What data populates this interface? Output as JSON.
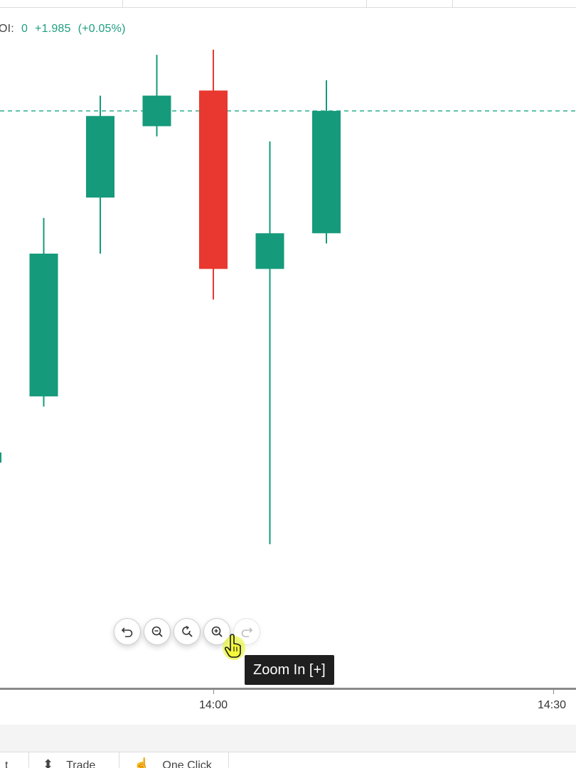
{
  "readout": {
    "label": "OI:",
    "oi_value": "0",
    "change": "+1.985",
    "change_pct": "(+0.05%)"
  },
  "colors": {
    "bullish": "#159a7b",
    "bearish": "#e8382f",
    "price_line": "#2fae8e"
  },
  "chart_data": {
    "type": "candlestick",
    "x_ticks": [
      "14:00",
      "14:30"
    ],
    "price_line": "dashed horizontal line at the last price",
    "candles": [
      {
        "direction": "up",
        "open": 0.2,
        "close": 0.22,
        "high": 0.26,
        "low": 0.18
      },
      {
        "direction": "up",
        "open": 0.33,
        "close": 0.61,
        "high": 0.68,
        "low": 0.31
      },
      {
        "direction": "up",
        "open": 0.72,
        "close": 0.88,
        "high": 0.92,
        "low": 0.61
      },
      {
        "direction": "up",
        "open": 0.86,
        "close": 0.92,
        "high": 1.0,
        "low": 0.84
      },
      {
        "direction": "down",
        "open": 0.93,
        "close": 0.58,
        "high": 1.01,
        "low": 0.52
      },
      {
        "direction": "up",
        "open": 0.58,
        "close": 0.65,
        "high": 0.83,
        "low": 0.04
      },
      {
        "direction": "up",
        "open": 0.65,
        "close": 0.89,
        "high": 0.95,
        "low": 0.63
      }
    ],
    "last_price": 0.89
  },
  "zoom_controls": {
    "buttons": [
      {
        "name": "undo-button",
        "icon": "undo-icon",
        "enabled": true
      },
      {
        "name": "zoom-out-button",
        "icon": "zoom-out-icon",
        "enabled": true
      },
      {
        "name": "reset-zoom-button",
        "icon": "reset-icon",
        "enabled": true
      },
      {
        "name": "zoom-in-button",
        "icon": "zoom-in-icon",
        "enabled": true
      },
      {
        "name": "redo-button",
        "icon": "redo-icon",
        "enabled": false
      }
    ],
    "tooltip": "Zoom In [+]"
  },
  "x_axis": {
    "labels": [
      "14:00",
      "14:30"
    ]
  },
  "bottom_tabs": [
    {
      "icon": "chart-icon",
      "label": "t"
    },
    {
      "icon": "trade-icon",
      "label": "Trade"
    },
    {
      "icon": "one-click-icon",
      "label": "One Click"
    }
  ]
}
